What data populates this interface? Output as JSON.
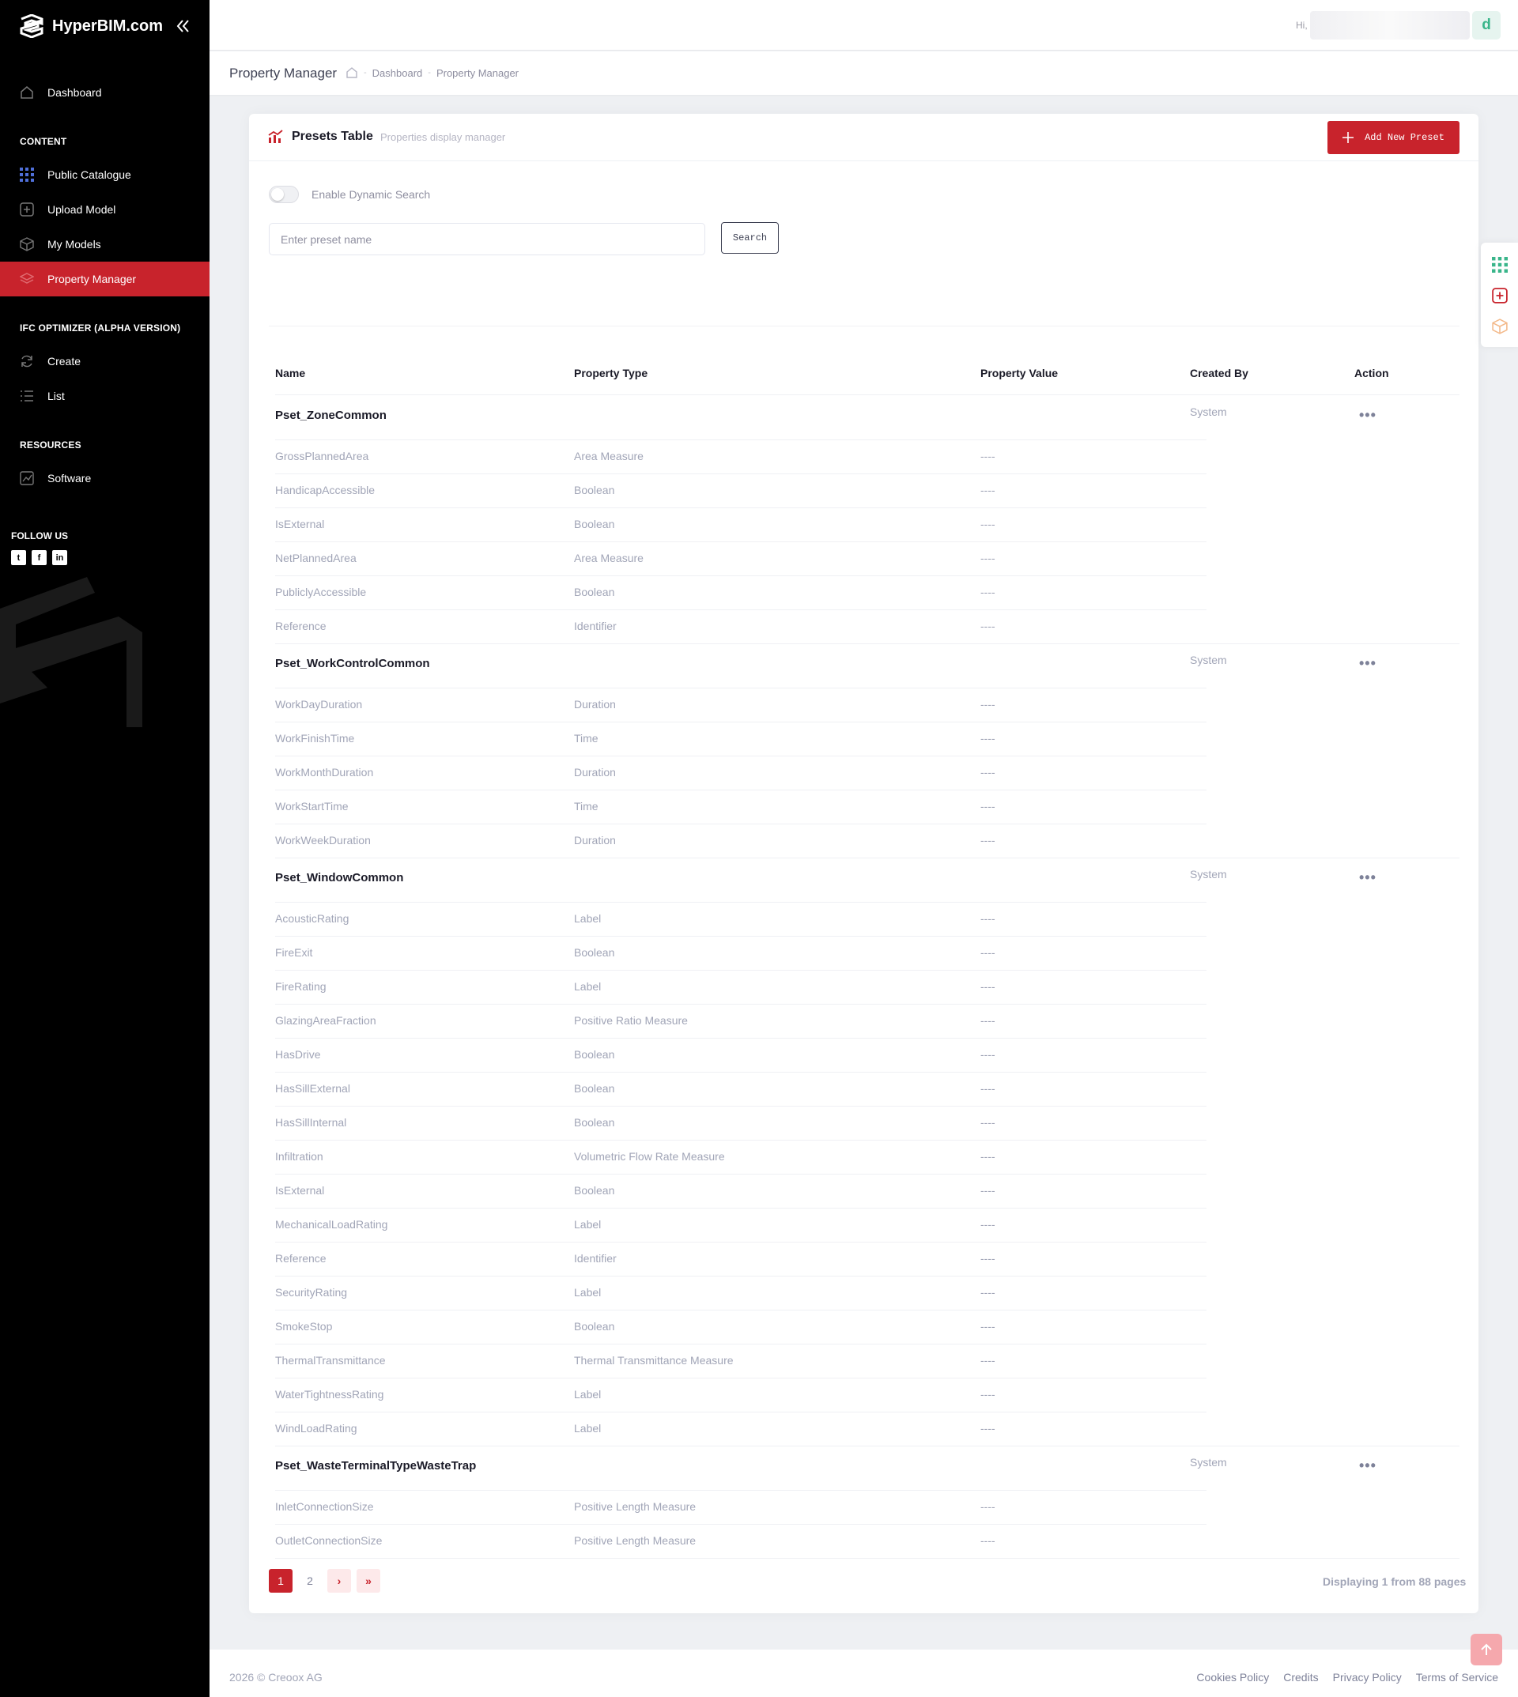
{
  "sidebar": {
    "brand": "HyperBIM.com",
    "dashboard": "Dashboard",
    "sections": {
      "content": "CONTENT",
      "ifc": "IFC OPTIMIZER (ALPHA VERSION)",
      "resources": "RESOURCES"
    },
    "items": [
      "Public Catalogue",
      "Upload Model",
      "My Models",
      "Property Manager"
    ],
    "ifc_items": [
      "Create",
      "List"
    ],
    "resources_items": [
      "Software"
    ],
    "follow": "FOLLOW US",
    "social_icons": [
      "twitter-icon",
      "facebook-icon",
      "linkedin-icon"
    ],
    "active_color": "#c8232c"
  },
  "topbar": {
    "greeting": "Hi,",
    "avatar_letter": "d"
  },
  "subheader": {
    "title": "Property Manager",
    "crumbs": [
      "Dashboard",
      "Property Manager"
    ]
  },
  "card": {
    "title": "Presets Table",
    "subtitle": "Properties display manager",
    "add_button": "Add New Preset",
    "toggle_label": "Enable Dynamic Search",
    "toggle_on": false,
    "search_placeholder": "Enter preset name",
    "search_button": "Search"
  },
  "table": {
    "headers": [
      "Name",
      "Property Type",
      "Property Value",
      "Created By",
      "Action"
    ],
    "groups": [
      {
        "name": "Pset_ZoneCommon",
        "created_by": "System",
        "rows": [
          [
            "GrossPlannedArea",
            "Area Measure",
            "----"
          ],
          [
            "HandicapAccessible",
            "Boolean",
            "----"
          ],
          [
            "IsExternal",
            "Boolean",
            "----"
          ],
          [
            "NetPlannedArea",
            "Area Measure",
            "----"
          ],
          [
            "PubliclyAccessible",
            "Boolean",
            "----"
          ],
          [
            "Reference",
            "Identifier",
            "----"
          ]
        ]
      },
      {
        "name": "Pset_WorkControlCommon",
        "created_by": "System",
        "rows": [
          [
            "WorkDayDuration",
            "Duration",
            "----"
          ],
          [
            "WorkFinishTime",
            "Time",
            "----"
          ],
          [
            "WorkMonthDuration",
            "Duration",
            "----"
          ],
          [
            "WorkStartTime",
            "Time",
            "----"
          ],
          [
            "WorkWeekDuration",
            "Duration",
            "----"
          ]
        ]
      },
      {
        "name": "Pset_WindowCommon",
        "created_by": "System",
        "rows": [
          [
            "AcousticRating",
            "Label",
            "----"
          ],
          [
            "FireExit",
            "Boolean",
            "----"
          ],
          [
            "FireRating",
            "Label",
            "----"
          ],
          [
            "GlazingAreaFraction",
            "Positive Ratio Measure",
            "----"
          ],
          [
            "HasDrive",
            "Boolean",
            "----"
          ],
          [
            "HasSillExternal",
            "Boolean",
            "----"
          ],
          [
            "HasSillInternal",
            "Boolean",
            "----"
          ],
          [
            "Infiltration",
            "Volumetric Flow Rate Measure",
            "----"
          ],
          [
            "IsExternal",
            "Boolean",
            "----"
          ],
          [
            "MechanicalLoadRating",
            "Label",
            "----"
          ],
          [
            "Reference",
            "Identifier",
            "----"
          ],
          [
            "SecurityRating",
            "Label",
            "----"
          ],
          [
            "SmokeStop",
            "Boolean",
            "----"
          ],
          [
            "ThermalTransmittance",
            "Thermal Transmittance Measure",
            "----"
          ],
          [
            "WaterTightnessRating",
            "Label",
            "----"
          ],
          [
            "WindLoadRating",
            "Label",
            "----"
          ]
        ]
      },
      {
        "name": "Pset_WasteTerminalTypeWasteTrap",
        "created_by": "System",
        "rows": [
          [
            "InletConnectionSize",
            "Positive Length Measure",
            "----"
          ],
          [
            "OutletConnectionSize",
            "Positive Length Measure",
            "----"
          ]
        ]
      }
    ],
    "action_glyph": "•••"
  },
  "pagination": {
    "pages": [
      "1",
      "2"
    ],
    "current": "1",
    "next": "›",
    "last": "»",
    "summary": "Displaying 1 from 88 pages"
  },
  "footer": {
    "copyright": "2026 © Creoox AG",
    "links": [
      "Cookies Policy",
      "Credits",
      "Privacy Policy",
      "Terms of Service"
    ]
  }
}
